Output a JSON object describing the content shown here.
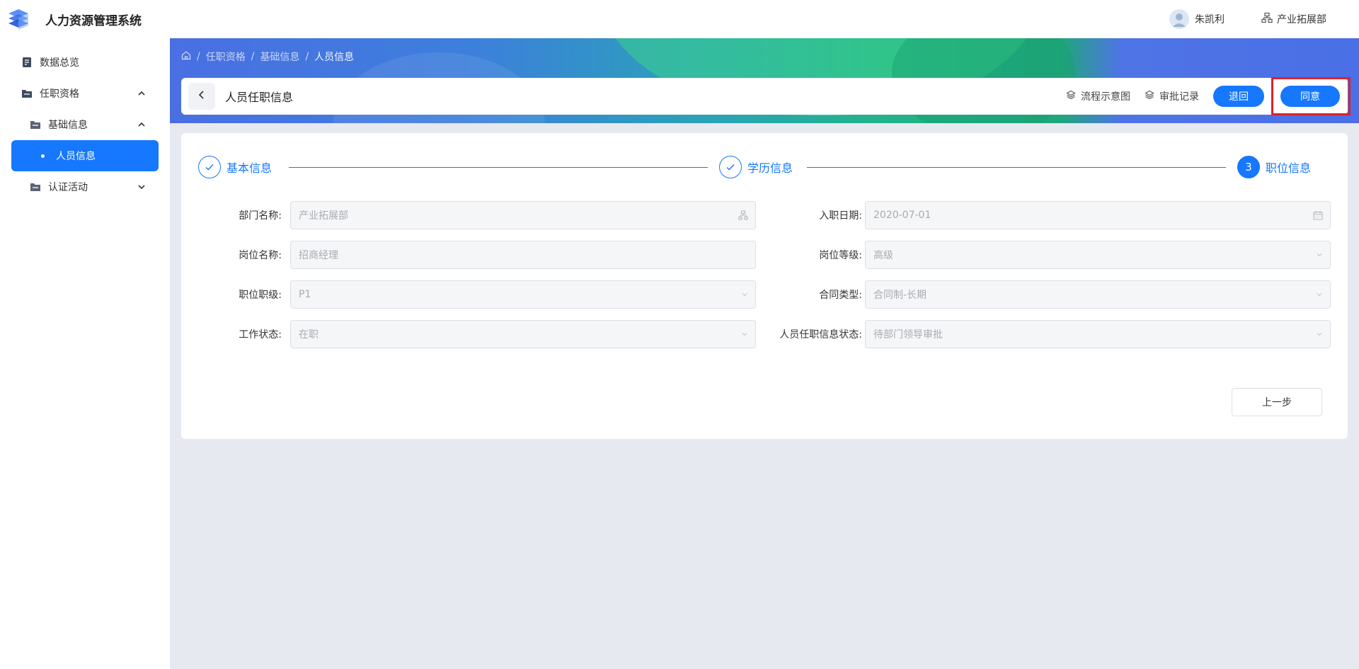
{
  "app": {
    "title": "人力资源管理系统"
  },
  "user": {
    "name": "朱凯利",
    "department": "产业拓展部"
  },
  "sidebar": {
    "items": [
      {
        "label": "数据总览"
      },
      {
        "label": "任职资格"
      },
      {
        "label": "基础信息"
      },
      {
        "label": "人员信息"
      },
      {
        "label": "认证活动"
      }
    ]
  },
  "breadcrumb": {
    "items": [
      "任职资格",
      "基础信息",
      "人员信息"
    ]
  },
  "header": {
    "title": "人员任职信息",
    "flow_label": "流程示意图",
    "records_label": "审批记录",
    "reject_label": "退回",
    "agree_label": "同意"
  },
  "steps": [
    {
      "label": "基本信息",
      "status": "done"
    },
    {
      "label": "学历信息",
      "status": "done"
    },
    {
      "label": "职位信息",
      "status": "current",
      "number": "3"
    }
  ],
  "form": {
    "department": {
      "label": "部门名称:",
      "value": "产业拓展部"
    },
    "join_date": {
      "label": "入职日期:",
      "value": "2020-07-01"
    },
    "position_name": {
      "label": "岗位名称:",
      "value": "招商经理"
    },
    "position_level": {
      "label": "岗位等级:",
      "value": "高级"
    },
    "job_grade": {
      "label": "职位职级:",
      "value": "P1"
    },
    "contract_type": {
      "label": "合同类型:",
      "value": "合同制-长期"
    },
    "work_status": {
      "label": "工作状态:",
      "value": "在职"
    },
    "info_status": {
      "label": "人员任职信息状态:",
      "value": "待部门领导审批"
    }
  },
  "actions": {
    "prev_label": "上一步"
  },
  "colors": {
    "primary": "#1677ff",
    "highlight": "#d9232d"
  }
}
